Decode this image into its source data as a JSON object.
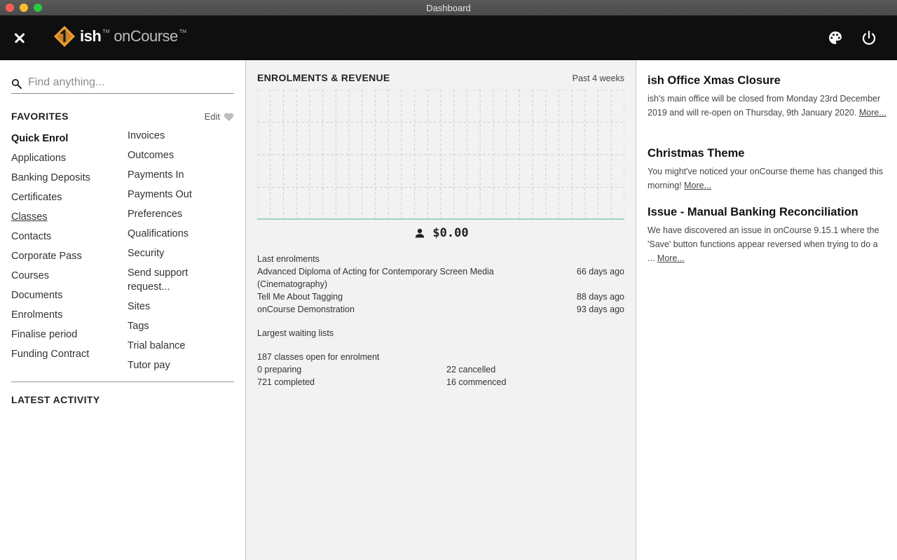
{
  "window": {
    "title": "Dashboard"
  },
  "header": {
    "logo_primary": "ish",
    "logo_secondary": "onCourse",
    "logo_tm": "TM",
    "icons": [
      "close-icon",
      "palette-icon",
      "power-icon"
    ],
    "colors": {
      "bar": "#0f0f0f",
      "logo_accent": "#f0a030"
    }
  },
  "sidebar": {
    "search": {
      "placeholder": "Find anything..."
    },
    "favorites": {
      "title": "FAVORITES",
      "edit_label": "Edit",
      "col1": [
        "Quick Enrol",
        "Applications",
        "Banking Deposits",
        "Certificates",
        "Classes",
        "Contacts",
        "Corporate Pass",
        "Courses",
        "Documents",
        "Enrolments",
        "Finalise period",
        "Funding Contract"
      ],
      "col2": [
        "Invoices",
        "Outcomes",
        "Payments In",
        "Payments Out",
        "Preferences",
        "Qualifications",
        "Security",
        "Send support request...",
        "Sites",
        "Tags",
        "Trial balance",
        "Tutor pay"
      ]
    },
    "latest_activity_title": "LATEST ACTIVITY"
  },
  "main": {
    "title": "ENROLMENTS & REVENUE",
    "period": "Past 4 weeks",
    "revenue": "$0.00",
    "last_enrolments_label": "Last enrolments",
    "last_enrolments": [
      {
        "name": "Advanced Diploma of Acting for Contemporary Screen Media (Cinematography)",
        "when": "66 days ago"
      },
      {
        "name": "Tell Me About Tagging",
        "when": "88 days ago"
      },
      {
        "name": "onCourse Demonstration",
        "when": "93 days ago"
      }
    ],
    "waiting_lists_label": "Largest waiting lists",
    "classes_open": "187 classes open for enrolment",
    "stats": {
      "preparing": "0 preparing",
      "cancelled": "22 cancelled",
      "completed": "721 completed",
      "commenced": "16 commenced"
    }
  },
  "news": [
    {
      "title": "ish Office Xmas Closure",
      "body": "ish's main office will be closed from Monday 23rd December 2019 and will re-open on Thursday, 9th January 2020.",
      "more": "More..."
    },
    {
      "title": "Christmas Theme",
      "body": "You might've noticed your onCourse theme has changed this morning!",
      "more": "More..."
    },
    {
      "title": "Issue - Manual Banking Reconciliation",
      "body": "We have discovered an issue in onCourse 9.15.1 where the 'Save' button functions appear reversed when trying to do a ...",
      "more": "More..."
    }
  ]
}
